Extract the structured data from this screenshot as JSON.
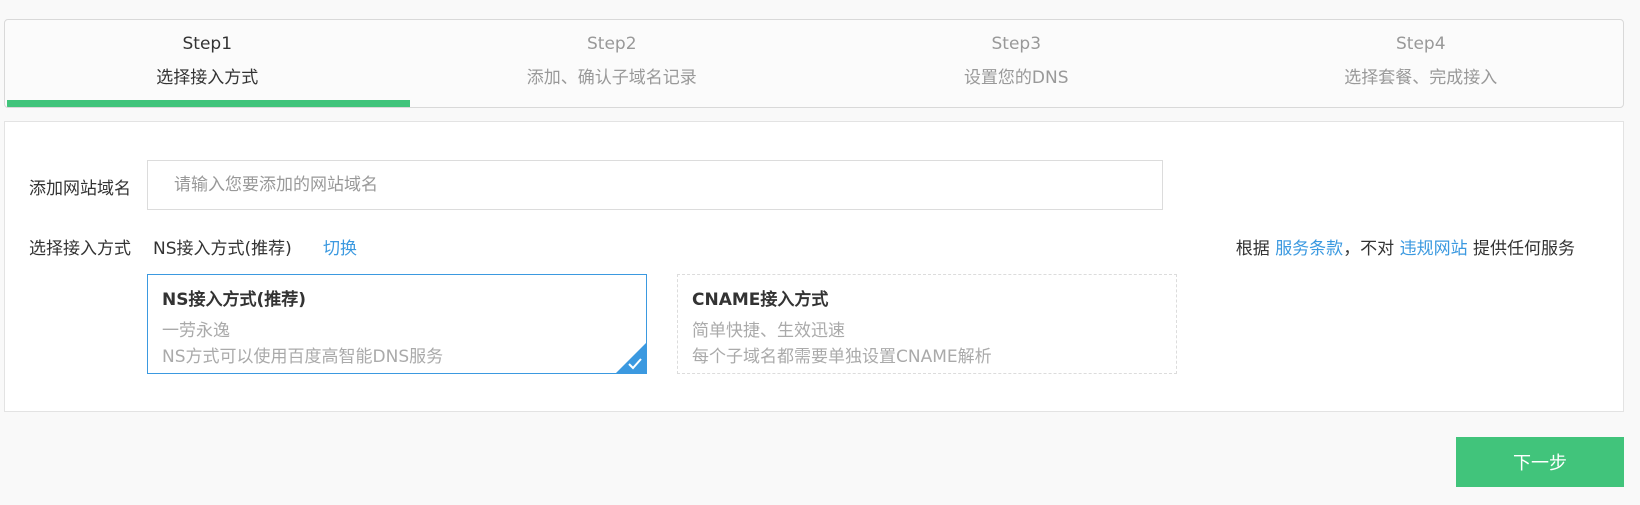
{
  "steps": [
    {
      "num": "Step1",
      "title": "选择接入方式",
      "active": true
    },
    {
      "num": "Step2",
      "title": "添加、确认子域名记录",
      "active": false
    },
    {
      "num": "Step3",
      "title": "设置您的DNS",
      "active": false
    },
    {
      "num": "Step4",
      "title": "选择套餐、完成接入",
      "active": false
    }
  ],
  "form": {
    "domain_label": "添加网站域名",
    "domain_placeholder": "请输入您要添加的网站域名",
    "domain_value": "",
    "method_label": "选择接入方式",
    "method_current": "NS接入方式(推荐)",
    "switch_label": "切换"
  },
  "terms": {
    "prefix": "根据",
    "link1": "服务条款",
    "middle": "，不对",
    "link2": "违规网站",
    "suffix": "提供任何服务"
  },
  "cards": [
    {
      "title": "NS接入方式(推荐)",
      "line1": "一劳永逸",
      "line2": "NS方式可以使用百度高智能DNS服务",
      "selected": true
    },
    {
      "title": "CNAME接入方式",
      "line1": "简单快捷、生效迅速",
      "line2": "每个子域名都需要单独设置CNAME解析",
      "selected": false
    }
  ],
  "next_button": "下一步",
  "colors": {
    "accent_green": "#41c47b",
    "link_blue": "#3b99e0",
    "selected_border": "#3b99e0"
  }
}
